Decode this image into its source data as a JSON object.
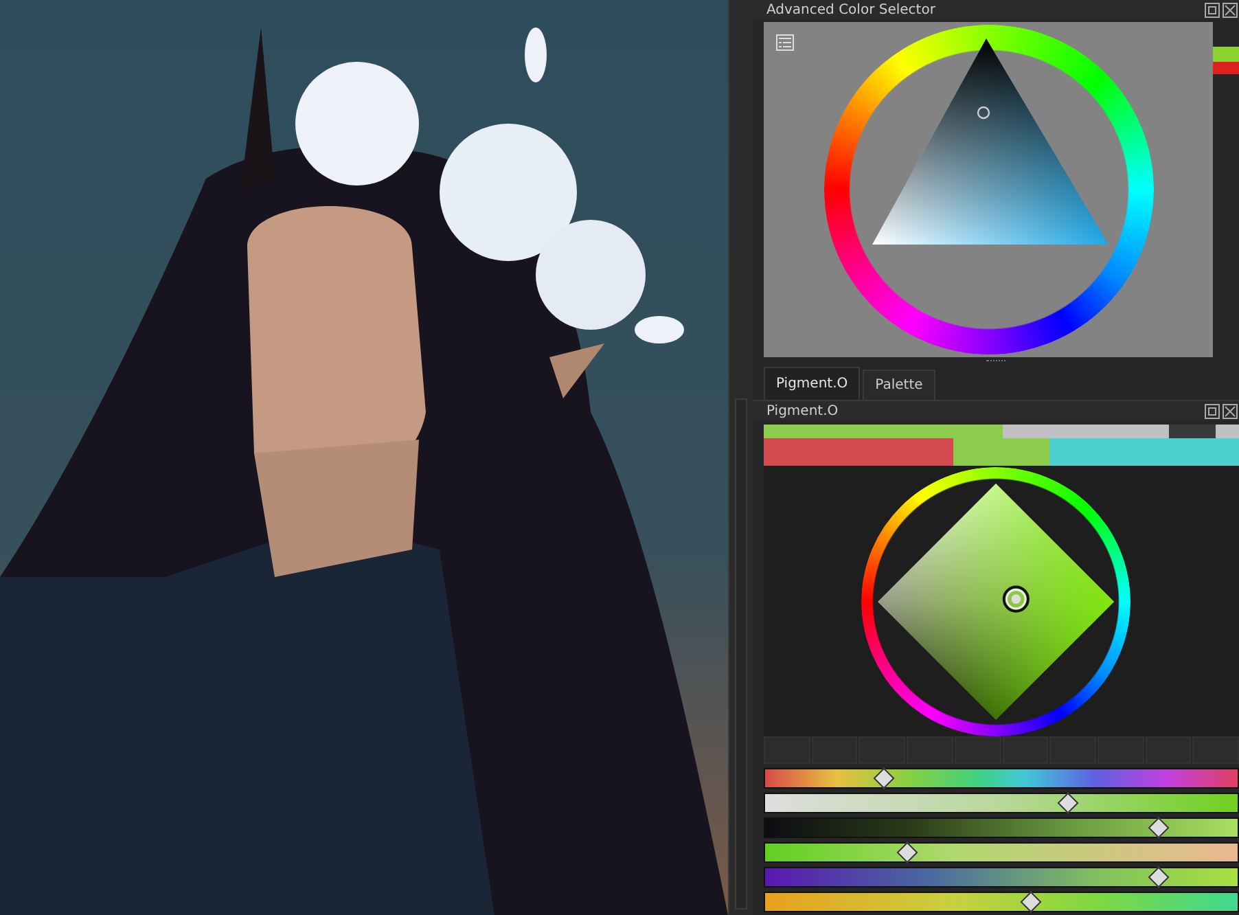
{
  "advanced_color_selector": {
    "title": "Advanced Color Selector"
  },
  "dock_tabs": [
    {
      "label": "Pigment.O",
      "selected": true
    },
    {
      "label": "Palette",
      "selected": false
    }
  ],
  "pigment_o": {
    "title": "Pigment.O",
    "sliders": [
      {
        "level": 0.25
      },
      {
        "level": 0.64
      },
      {
        "level": 0.83
      },
      {
        "level": 0.3
      },
      {
        "level": 0.83
      },
      {
        "level": 0.56
      }
    ]
  }
}
